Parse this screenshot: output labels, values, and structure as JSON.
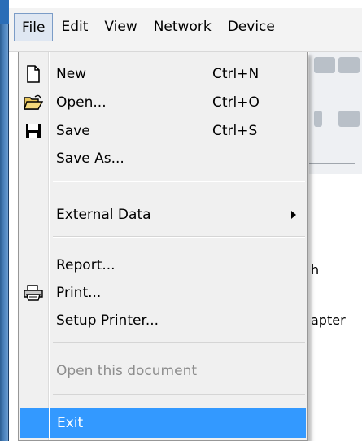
{
  "menubar": {
    "items": [
      {
        "label": "File",
        "active": true
      },
      {
        "label": "Edit"
      },
      {
        "label": "View"
      },
      {
        "label": "Network"
      },
      {
        "label": "Device"
      }
    ]
  },
  "background": {
    "text1": "h",
    "text2": "apter"
  },
  "file_menu": {
    "items": [
      {
        "label": "New",
        "shortcut": "Ctrl+N",
        "icon": "new-document-icon"
      },
      {
        "label": "Open...",
        "shortcut": "Ctrl+O",
        "icon": "open-folder-icon"
      },
      {
        "label": "Save",
        "shortcut": "Ctrl+S",
        "icon": "floppy-disk-icon"
      },
      {
        "label": "Save As..."
      },
      {
        "label": "External Data",
        "submenu": true
      },
      {
        "label": "Report..."
      },
      {
        "label": "Print...",
        "icon": "printer-icon"
      },
      {
        "label": "Setup Printer..."
      },
      {
        "label": "Open this document",
        "disabled": true
      },
      {
        "label": "Exit",
        "highlighted": true
      }
    ]
  },
  "colors": {
    "highlight": "#3399ff",
    "window_edge": "#4f86c0",
    "disabled_text": "#8d8d8d"
  }
}
